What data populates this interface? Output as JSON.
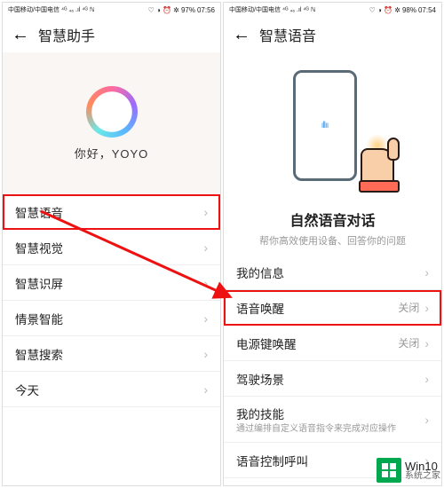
{
  "left": {
    "status": {
      "carrier": "中国移动/中国电信",
      "signal": "⁴ᴳ ₄₆ .ıl ⁴ᴳ",
      "nfc": "ℕ",
      "icons": "♡ ◑ ⏰ ✲",
      "battery": "97%",
      "time": "07:56"
    },
    "header": {
      "title": "智慧助手"
    },
    "hero": {
      "greeting": "你好，YOYO"
    },
    "menu": [
      {
        "label": "智慧语音",
        "highlight": true
      },
      {
        "label": "智慧视觉"
      },
      {
        "label": "智慧识屏"
      },
      {
        "label": "情景智能"
      },
      {
        "label": "智慧搜索"
      },
      {
        "label": "今天"
      }
    ]
  },
  "right": {
    "status": {
      "carrier": "中国移动/中国电信",
      "signal": "⁴ᴳ ₄₆ .ıl ⁴ᴳ",
      "nfc": "ℕ",
      "icons": "♡ ◑ ⏰ ✲",
      "battery": "98%",
      "time": "07:54"
    },
    "header": {
      "title": "智慧语音"
    },
    "hero": {
      "title": "自然语音对话",
      "subtitle": "帮你高效使用设备、回答你的问题"
    },
    "menu": [
      {
        "label": "我的信息"
      },
      {
        "label": "语音唤醒",
        "value": "关闭",
        "highlight": true
      },
      {
        "label": "电源键唤醒",
        "value": "关闭"
      },
      {
        "label": "驾驶场景"
      },
      {
        "label": "我的技能",
        "sub": "通过编排自定义语音指令来完成对应操作"
      },
      {
        "label": "语音控制呼叫"
      }
    ]
  },
  "watermark": {
    "line1": "Win10",
    "line2": "系统之家"
  }
}
